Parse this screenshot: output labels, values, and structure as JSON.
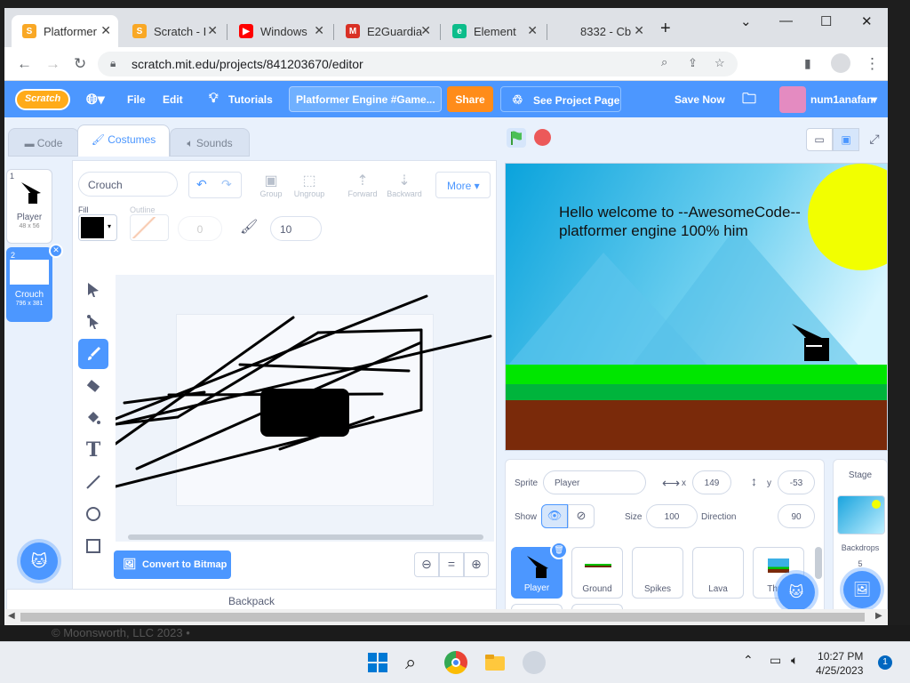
{
  "browser": {
    "tabs": [
      {
        "title": "Platformer",
        "icon": "scratch-favicon",
        "active": true
      },
      {
        "title": "Scratch - I",
        "icon": "scratch-favicon"
      },
      {
        "title": "Windows",
        "icon": "youtube-favicon"
      },
      {
        "title": "E2Guardia",
        "icon": "gmail-favicon"
      },
      {
        "title": "Element",
        "icon": "element-favicon"
      },
      {
        "title": "8332 - Cb",
        "icon": "blank-favicon"
      }
    ],
    "url": "scratch.mit.edu/projects/841203670/editor"
  },
  "menubar": {
    "logo": "Scratch",
    "file": "File",
    "edit": "Edit",
    "tutorials": "Tutorials",
    "project_title": "Platformer Engine #Game...",
    "share": "Share",
    "see_project": "See Project Page",
    "save_now": "Save Now",
    "username": "num1anafan"
  },
  "editor_tabs": {
    "code": "Code",
    "costumes": "Costumes",
    "sounds": "Sounds"
  },
  "costumes": [
    {
      "num": "1",
      "name": "Player",
      "size": "48 x 56"
    },
    {
      "num": "2",
      "name": "Crouch",
      "size": "796 x 381"
    }
  ],
  "paint": {
    "costume_name": "Crouch",
    "group": "Group",
    "ungroup": "Ungroup",
    "forward": "Forward",
    "backward": "Backward",
    "more": "More",
    "fill_label": "Fill",
    "outline_label": "Outline",
    "outline_width": "0",
    "brush_size": "10",
    "convert": "Convert to Bitmap",
    "zoom_reset": "="
  },
  "backpack": "Backpack",
  "stage": {
    "text_line1": "Hello welcome to --AwesomeCode--",
    "text_line2": "platformer engine 100% him"
  },
  "sprite_info": {
    "sprite_label": "Sprite",
    "sprite_name": "Player",
    "x_label": "x",
    "x": "149",
    "y_label": "y",
    "y": "-53",
    "show_label": "Show",
    "size_label": "Size",
    "size": "100",
    "direction_label": "Direction",
    "direction": "90"
  },
  "sprites": [
    {
      "name": "Player",
      "selected": true
    },
    {
      "name": "Ground"
    },
    {
      "name": "Spikes"
    },
    {
      "name": "Lava"
    },
    {
      "name": "Thum"
    }
  ],
  "stage_panel": {
    "title": "Stage",
    "backdrops_label": "Backdrops",
    "backdrops_count": "5"
  },
  "background_page": "© Moonsworth, LLC 2023 •",
  "taskbar": {
    "time": "10:27 PM",
    "date": "4/25/2023",
    "notifications": "1"
  },
  "colors": {
    "scratch_blue": "#4c97ff",
    "share_orange": "#ff8c1a",
    "stage_grass": "#00e600",
    "stage_dirt": "#7a2a0a"
  }
}
